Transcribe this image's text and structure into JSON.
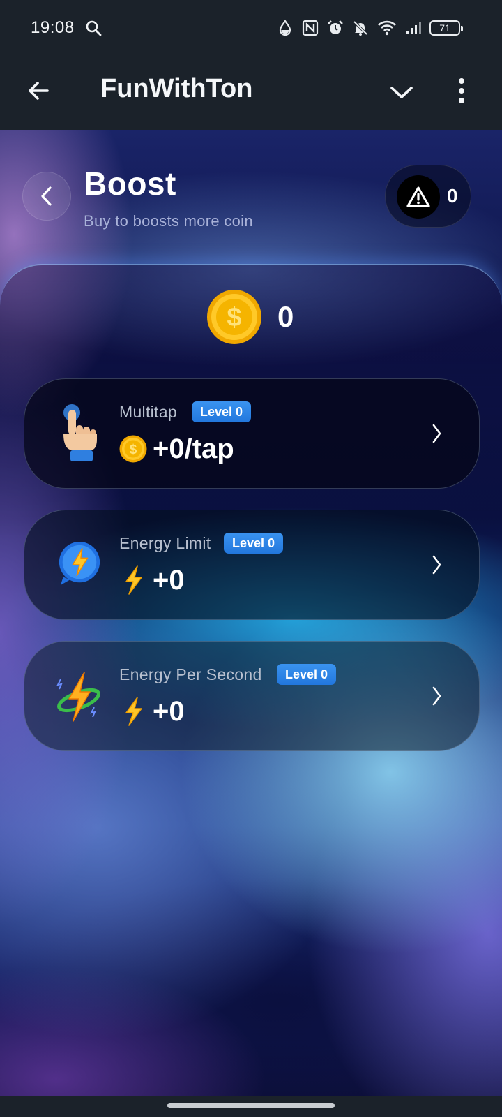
{
  "status_bar": {
    "time": "19:08",
    "battery": "71"
  },
  "app_bar": {
    "title": "FunWithTon"
  },
  "page": {
    "title": "Boost",
    "subtitle": "Buy to boosts more coin",
    "warning_count": "0"
  },
  "balance": {
    "value": "0"
  },
  "boosts": [
    {
      "name": "Multitap",
      "level": "Level 0",
      "value": "+0/tap",
      "icon": "tap-hand-icon",
      "value_icon": "coin-icon"
    },
    {
      "name": "Energy Limit",
      "level": "Level 0",
      "value": "+0",
      "icon": "energy-bubble-icon",
      "value_icon": "lightning-icon"
    },
    {
      "name": "Energy Per Second",
      "level": "Level 0",
      "value": "+0",
      "icon": "energy-orbit-icon",
      "value_icon": "lightning-icon"
    }
  ],
  "colors": {
    "badge": "#2b86e8",
    "coin": "#f5b400",
    "background": "#1b222a"
  }
}
